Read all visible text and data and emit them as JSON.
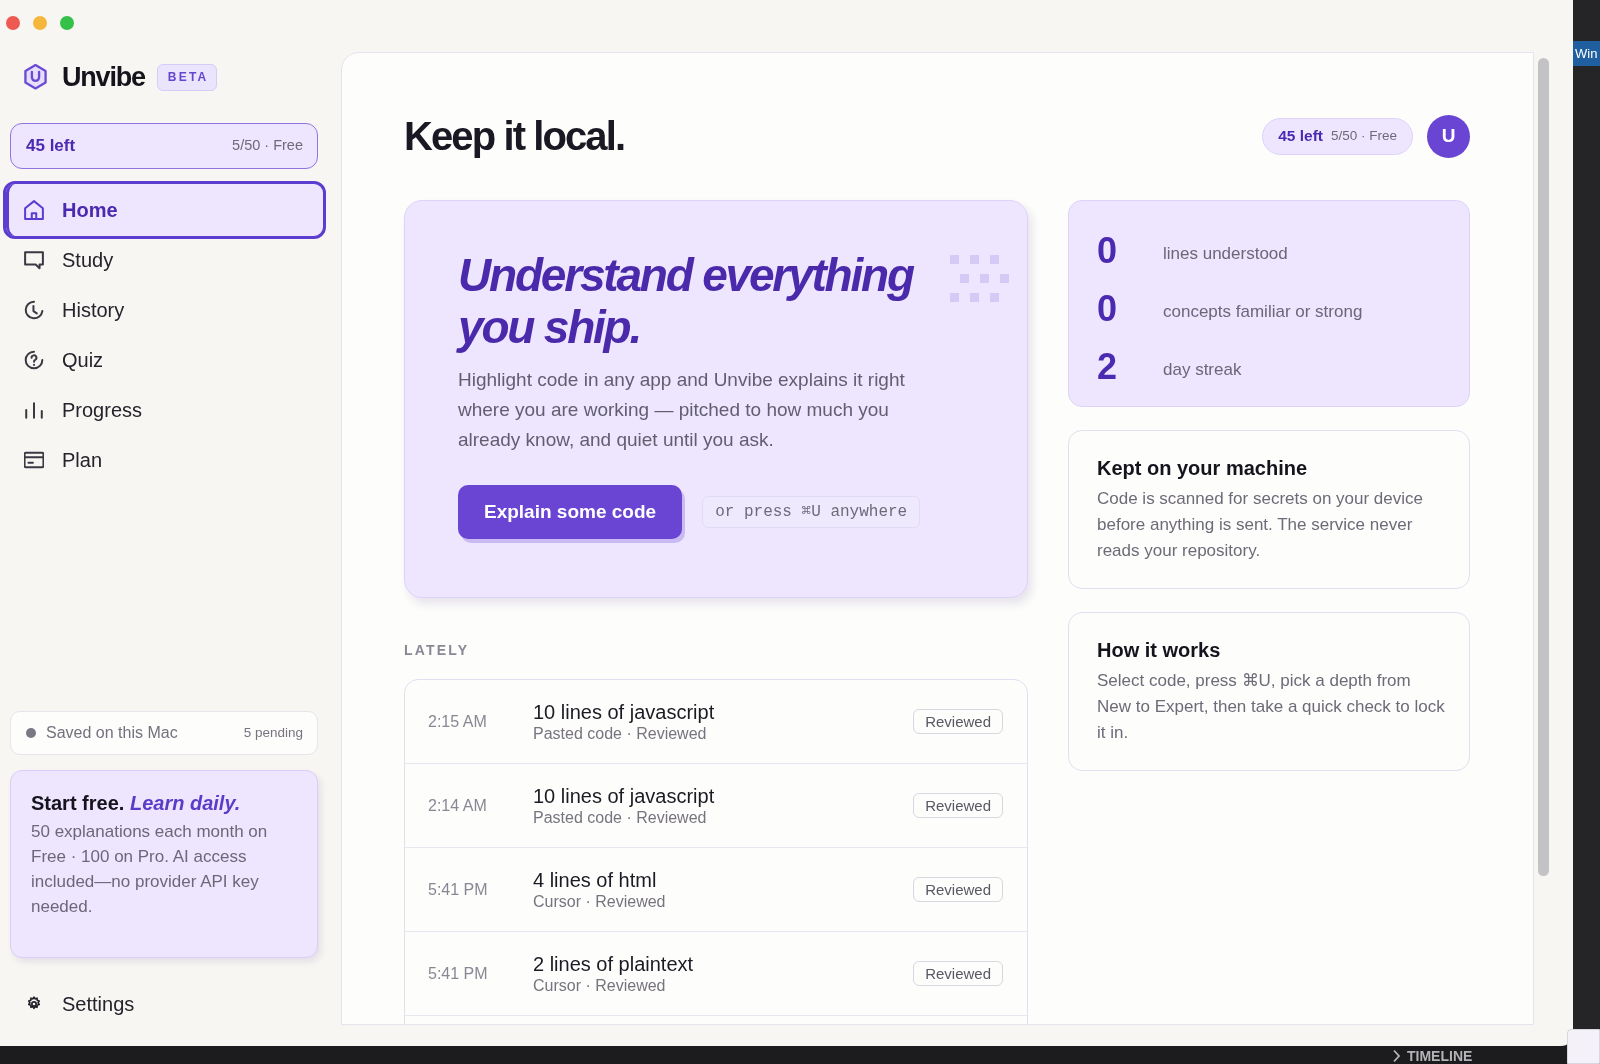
{
  "sidebar": {
    "brand": {
      "name": "Unvibe",
      "badge": "BETA"
    },
    "usage": {
      "remaining": "45 left",
      "detail": "5/50 · Free"
    },
    "nav": [
      {
        "label": "Home",
        "selected": true
      },
      {
        "label": "Study",
        "selected": false
      },
      {
        "label": "History",
        "selected": false
      },
      {
        "label": "Quiz",
        "selected": false
      },
      {
        "label": "Progress",
        "selected": false
      },
      {
        "label": "Plan",
        "selected": false
      }
    ],
    "sync": {
      "label": "Saved on this Mac",
      "pending": "5 pending"
    },
    "promo": {
      "title": "Start free. *Learn daily.*",
      "body": "50 explanations each month on Free · 100 on Pro. AI access included—no provider API key needed."
    },
    "settings": {
      "label": "Settings"
    }
  },
  "main": {
    "title": "Keep it local.",
    "usage": {
      "remaining": "45 left",
      "detail": "5/50 · Free"
    },
    "avatar": "U",
    "hero": {
      "title": "Understand everything you ship.",
      "body": "Highlight code in any app and Unvibe explains it right where you are working — pitched to how much you already know, and quiet until you ask.",
      "button": "Explain some code",
      "shortcut": "or press ⌘U anywhere"
    },
    "lately": {
      "heading": "LATELY",
      "items": [
        {
          "time": "2:15 AM",
          "title": "10 lines of javascript",
          "meta": "Pasted code · Reviewed",
          "status": "Reviewed"
        },
        {
          "time": "2:14 AM",
          "title": "10 lines of javascript",
          "meta": "Pasted code · Reviewed",
          "status": "Reviewed"
        },
        {
          "time": "5:41 PM",
          "title": "4 lines of html",
          "meta": "Cursor · Reviewed",
          "status": "Reviewed"
        },
        {
          "time": "5:41 PM",
          "title": "2 lines of plaintext",
          "meta": "Cursor · Reviewed",
          "status": "Reviewed"
        }
      ]
    },
    "stats": [
      {
        "value": "0",
        "label": "lines understood"
      },
      {
        "value": "0",
        "label": "concepts familiar or strong"
      },
      {
        "value": "2",
        "label": "day streak"
      }
    ],
    "cards": [
      {
        "title": "Kept on your machine",
        "body": "Code is scanned for secrets on your device before anything is sent. The service never reads your repository."
      },
      {
        "title": "How it works",
        "body": "Select code, press ⌘U, pick a depth from New to Expert, then take a quick check to lock it in."
      }
    ]
  },
  "background": {
    "tab": "Win",
    "timeline": "TIMELINE"
  }
}
